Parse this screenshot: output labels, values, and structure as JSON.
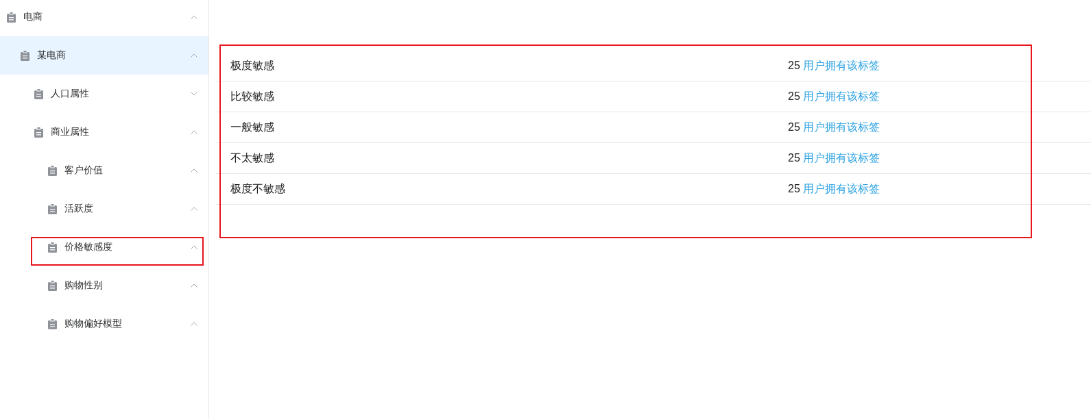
{
  "sidebar": {
    "items": [
      {
        "label": "电商",
        "selected": false,
        "expanded": true,
        "annotated": false,
        "children": [
          {
            "label": "某电商",
            "selected": true,
            "expanded": true,
            "annotated": false,
            "children": [
              {
                "label": "人口属性",
                "selected": false,
                "expanded": false,
                "annotated": false
              },
              {
                "label": "商业属性",
                "selected": false,
                "expanded": true,
                "annotated": false,
                "children": [
                  {
                    "label": "客户价值",
                    "selected": false,
                    "expanded": true,
                    "annotated": false
                  },
                  {
                    "label": "活跃度",
                    "selected": false,
                    "expanded": true,
                    "annotated": false
                  },
                  {
                    "label": "价格敏感度",
                    "selected": false,
                    "expanded": true,
                    "annotated": true
                  },
                  {
                    "label": "购物性别",
                    "selected": false,
                    "expanded": true,
                    "annotated": false
                  },
                  {
                    "label": "购物偏好模型",
                    "selected": false,
                    "expanded": true,
                    "annotated": false
                  }
                ]
              }
            ]
          }
        ]
      }
    ]
  },
  "table": {
    "annotated": true,
    "rows": [
      {
        "name": "极度敏感",
        "count": "25",
        "link": "用户拥有该标签"
      },
      {
        "name": "比较敏感",
        "count": "25",
        "link": "用户拥有该标签"
      },
      {
        "name": "一般敏感",
        "count": "25",
        "link": "用户拥有该标签"
      },
      {
        "name": "不太敏感",
        "count": "25",
        "link": "用户拥有该标签"
      },
      {
        "name": "极度不敏感",
        "count": "25",
        "link": "用户拥有该标签"
      }
    ]
  }
}
